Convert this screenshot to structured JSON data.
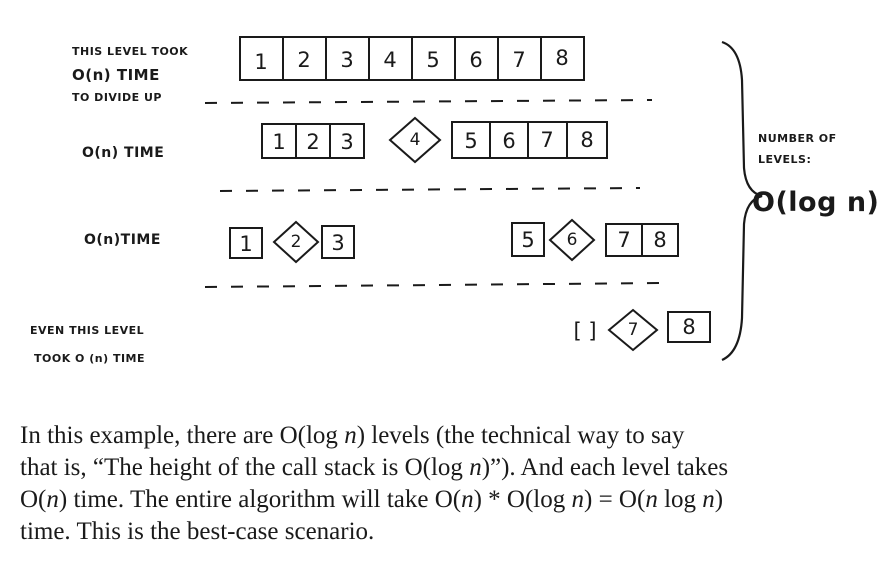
{
  "figure": {
    "labels": {
      "level1_line1": "THIS LEVEL TOOK",
      "level1_line2": "O(n) TIME",
      "level1_line3": "TO DIVIDE UP",
      "level2": "O(n) TIME",
      "level3": "O(n)TIME",
      "level4_line1": "EVEN THIS LEVEL",
      "level4_line2": "TOOK O (n) TIME",
      "brace_line1": "NUMBER OF",
      "brace_line2": "LEVELS:",
      "brace_big": "O(log n)"
    },
    "level1": [
      "1",
      "2",
      "3",
      "4",
      "5",
      "6",
      "7",
      "8"
    ],
    "level2": {
      "left": [
        "1",
        "2",
        "3"
      ],
      "pivot": "4",
      "right": [
        "5",
        "6",
        "7",
        "8"
      ]
    },
    "level3": {
      "left_a": [
        "1"
      ],
      "pivot_a": "2",
      "left_b": [
        "3"
      ],
      "right_a": [
        "5"
      ],
      "pivot_b": "6",
      "right_b": [
        "7",
        "8"
      ]
    },
    "level4": {
      "empty": "[ ]",
      "pivot": "7",
      "right": [
        "8"
      ]
    }
  },
  "paragraph": {
    "l1_a": "In this example, there are O(log ",
    "l1_n": "n",
    "l1_b": ") levels (the technical way to say",
    "l2_a": "that is, “The height of the call stack is O(log ",
    "l2_n": "n",
    "l2_b": ")”). And each level takes",
    "l3_a": "O(",
    "l3_n1": "n",
    "l3_b": ") time. The entire algorithm will take O(",
    "l3_n2": "n",
    "l3_c": ") * O(log ",
    "l3_n3": "n",
    "l3_d": ") = O(",
    "l3_n4": "n",
    "l3_e": " log ",
    "l3_n5": "n",
    "l3_f": ")",
    "l4": "time. This is the best-case scenario."
  }
}
